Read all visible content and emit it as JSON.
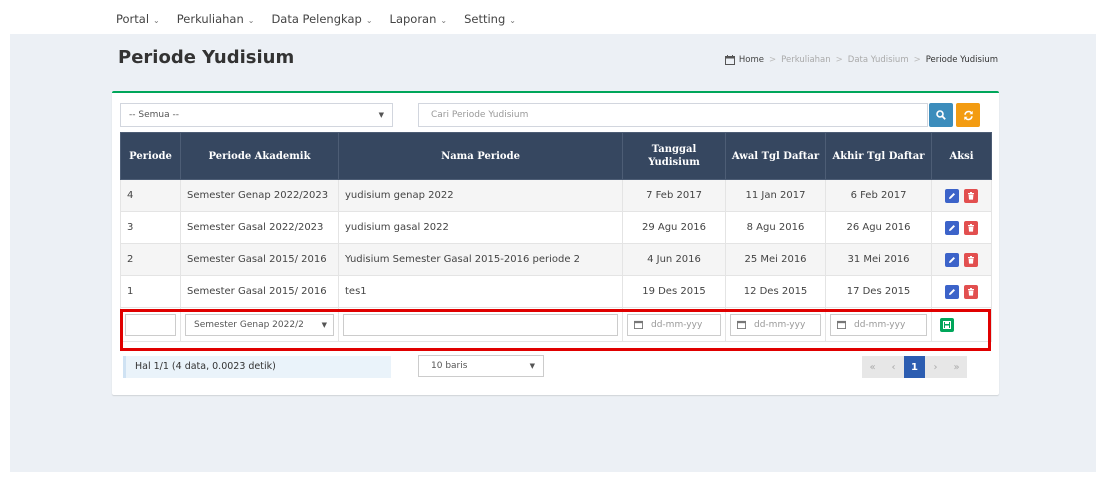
{
  "topnav": [
    {
      "label": "Portal"
    },
    {
      "label": "Perkuliahan"
    },
    {
      "label": "Data Pelengkap"
    },
    {
      "label": "Laporan"
    },
    {
      "label": "Setting"
    }
  ],
  "page_title": "Periode Yudisium",
  "breadcrumb": [
    "Home",
    "Perkuliahan",
    "Data Yudisium",
    "Periode Yudisium"
  ],
  "filter": {
    "select_value": "-- Semua --",
    "search_placeholder": "Cari Periode Yudisium"
  },
  "table": {
    "headers": [
      "Periode",
      "Periode Akademik",
      "Nama Periode",
      "Tanggal Yudisium",
      "Awal Tgl Daftar",
      "Akhir Tgl Daftar",
      "Aksi"
    ],
    "rows": [
      {
        "periode": "4",
        "akademik": "Semester Genap 2022/2023",
        "nama": "yudisium genap 2022",
        "tanggal": "7 Feb 2017",
        "awal": "11 Jan 2017",
        "akhir": "6 Feb 2017"
      },
      {
        "periode": "3",
        "akademik": "Semester Gasal 2022/2023",
        "nama": "yudisium gasal 2022",
        "tanggal": "29 Agu 2016",
        "awal": "8 Agu 2016",
        "akhir": "26 Agu 2016"
      },
      {
        "periode": "2",
        "akademik": "Semester Gasal 2015/ 2016",
        "nama": "Yudisium Semester Gasal 2015-2016 periode 2",
        "tanggal": "4 Jun 2016",
        "awal": "25 Mei 2016",
        "akhir": "31 Mei 2016"
      },
      {
        "periode": "1",
        "akademik": "Semester Gasal 2015/ 2016",
        "nama": "tes1",
        "tanggal": "19 Des 2015",
        "awal": "12 Des 2015",
        "akhir": "17 Des 2015"
      }
    ],
    "input_row": {
      "akademik_value": "Semester Genap 2022/2",
      "date_placeholder": "dd-mm-yyy"
    }
  },
  "footer": {
    "info": "Hal 1/1 (4 data, 0.0023 detik)",
    "rows_select": "10 baris",
    "pager": [
      "«",
      "‹",
      "1",
      "›",
      "»"
    ]
  },
  "colors": {
    "header_bg": "#364760",
    "edit": "#3c63c9",
    "delete": "#e24f4f",
    "save": "#00a65a",
    "search": "#3c8dbc",
    "refresh": "#f39c12",
    "highlight": "#e00000"
  }
}
